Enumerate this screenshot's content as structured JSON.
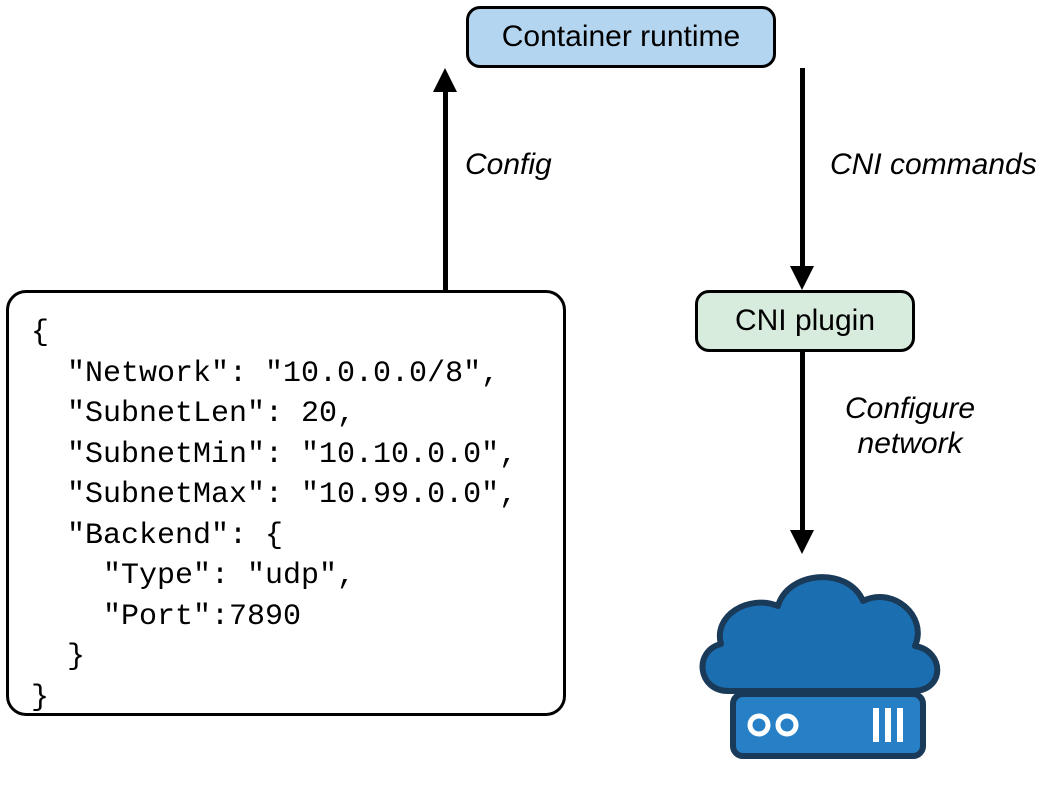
{
  "boxes": {
    "runtime": "Container runtime",
    "plugin": "CNI plugin"
  },
  "labels": {
    "config": "Config",
    "cni": "CNI commands",
    "configure_line1": "Configure",
    "configure_line2": "network"
  },
  "config_json": "{\n  \"Network\": \"10.0.0.0/8\",\n  \"SubnetLen\": 20,\n  \"SubnetMin\": \"10.10.0.0\",\n  \"SubnetMax\": \"10.99.0.0\",\n  \"Backend\": {\n    \"Type\": \"udp\",\n    \"Port\":7890\n  }\n}",
  "colors": {
    "runtime_bg": "#b4d5ef",
    "plugin_bg": "#d7ecdd",
    "cloud_fill": "#1b6fb0",
    "server_fill": "#277fc6",
    "outline": "#1a3a5a"
  }
}
